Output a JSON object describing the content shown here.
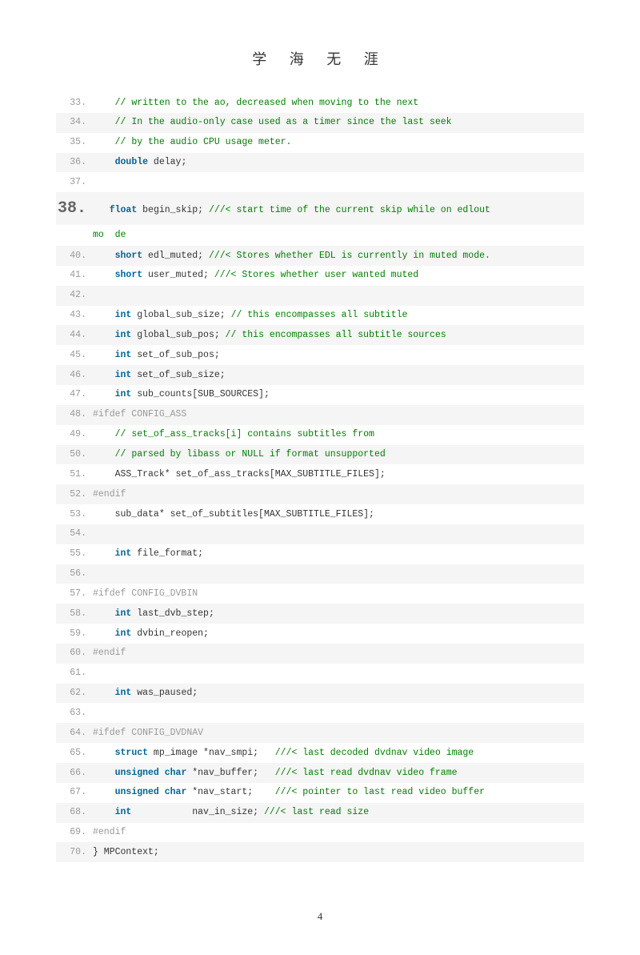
{
  "title": "学 海 无  涯",
  "page_number": "4",
  "lines": [
    {
      "n": "33.",
      "alt": false,
      "tokens": [
        {
          "t": "    ",
          "c": ""
        },
        {
          "t": "// written to the ao, decreased when moving to the next",
          "c": "comment"
        }
      ]
    },
    {
      "n": "34.",
      "alt": true,
      "tokens": [
        {
          "t": "    ",
          "c": ""
        },
        {
          "t": "// In the audio-only case used as a timer since the last seek",
          "c": "comment"
        }
      ]
    },
    {
      "n": "35.",
      "alt": false,
      "tokens": [
        {
          "t": "    ",
          "c": ""
        },
        {
          "t": "// by the audio CPU usage meter.",
          "c": "comment"
        }
      ]
    },
    {
      "n": "36.",
      "alt": true,
      "tokens": [
        {
          "t": "    ",
          "c": ""
        },
        {
          "t": "double",
          "c": "keyword"
        },
        {
          "t": " delay;",
          "c": "ident"
        }
      ]
    },
    {
      "n": "37.",
      "alt": false,
      "tokens": [
        {
          "t": "  ",
          "c": ""
        }
      ]
    },
    {
      "n": "38.",
      "alt": true,
      "big": true,
      "tokens": [
        {
          "t": "   ",
          "c": ""
        },
        {
          "t": "float",
          "c": "keyword"
        },
        {
          "t": " begin_skip; ",
          "c": "ident"
        },
        {
          "t": "///< start time of the current skip while on edlout",
          "c": "comment"
        }
      ],
      "wrap": [
        {
          "t": "mo  de",
          "c": "comment"
        }
      ]
    },
    {
      "n": "40.",
      "alt": true,
      "tokens": [
        {
          "t": "    ",
          "c": ""
        },
        {
          "t": "short",
          "c": "keyword"
        },
        {
          "t": " edl_muted; ",
          "c": "ident"
        },
        {
          "t": "///< Stores whether EDL is currently in muted mode.",
          "c": "comment"
        }
      ]
    },
    {
      "n": "41.",
      "alt": false,
      "tokens": [
        {
          "t": "    ",
          "c": ""
        },
        {
          "t": "short",
          "c": "keyword"
        },
        {
          "t": " user_muted; ",
          "c": "ident"
        },
        {
          "t": "///< Stores whether user wanted muted",
          "c": "comment"
        }
      ]
    },
    {
      "n": "42.",
      "alt": true,
      "tokens": [
        {
          "t": "  ",
          "c": ""
        }
      ]
    },
    {
      "n": "43.",
      "alt": false,
      "tokens": [
        {
          "t": "    ",
          "c": ""
        },
        {
          "t": "int",
          "c": "keyword"
        },
        {
          "t": " global_sub_size; ",
          "c": "ident"
        },
        {
          "t": "// this encompasses all subtitle",
          "c": "comment"
        }
      ]
    },
    {
      "n": "44.",
      "alt": true,
      "tokens": [
        {
          "t": "    ",
          "c": ""
        },
        {
          "t": "int",
          "c": "keyword"
        },
        {
          "t": " global_sub_pos; ",
          "c": "ident"
        },
        {
          "t": "// this encompasses all subtitle sources",
          "c": "comment"
        }
      ]
    },
    {
      "n": "45.",
      "alt": false,
      "tokens": [
        {
          "t": "    ",
          "c": ""
        },
        {
          "t": "int",
          "c": "keyword"
        },
        {
          "t": " set_of_sub_pos;",
          "c": "ident"
        }
      ]
    },
    {
      "n": "46.",
      "alt": true,
      "tokens": [
        {
          "t": "    ",
          "c": ""
        },
        {
          "t": "int",
          "c": "keyword"
        },
        {
          "t": " set_of_sub_size;",
          "c": "ident"
        }
      ]
    },
    {
      "n": "47.",
      "alt": false,
      "tokens": [
        {
          "t": "    ",
          "c": ""
        },
        {
          "t": "int",
          "c": "keyword"
        },
        {
          "t": " sub_counts[SUB_SOURCES];",
          "c": "ident"
        }
      ]
    },
    {
      "n": "48.",
      "alt": true,
      "tokens": [
        {
          "t": "#ifdef CONFIG_ASS",
          "c": "pp"
        }
      ]
    },
    {
      "n": "49.",
      "alt": false,
      "tokens": [
        {
          "t": "    ",
          "c": ""
        },
        {
          "t": "// set_of_ass_tracks[i] contains subtitles from",
          "c": "comment"
        }
      ]
    },
    {
      "n": "50.",
      "alt": true,
      "tokens": [
        {
          "t": "    ",
          "c": ""
        },
        {
          "t": "// parsed by libass or NULL if format unsupported",
          "c": "comment"
        }
      ]
    },
    {
      "n": "51.",
      "alt": false,
      "tokens": [
        {
          "t": "    ",
          "c": ""
        },
        {
          "t": "ASS_Track* set_of_ass_tracks[MAX_SUBTITLE_FILES];",
          "c": "ident"
        }
      ]
    },
    {
      "n": "52.",
      "alt": true,
      "tokens": [
        {
          "t": "#endif",
          "c": "pp"
        }
      ]
    },
    {
      "n": "53.",
      "alt": false,
      "tokens": [
        {
          "t": "    ",
          "c": ""
        },
        {
          "t": "sub_data* set_of_subtitles[MAX_SUBTITLE_FILES];",
          "c": "ident"
        }
      ]
    },
    {
      "n": "54.",
      "alt": true,
      "tokens": [
        {
          "t": "  ",
          "c": ""
        }
      ]
    },
    {
      "n": "55.",
      "alt": false,
      "tokens": [
        {
          "t": "    ",
          "c": ""
        },
        {
          "t": "int",
          "c": "keyword"
        },
        {
          "t": " file_format;",
          "c": "ident"
        }
      ]
    },
    {
      "n": "56.",
      "alt": true,
      "tokens": [
        {
          "t": "  ",
          "c": ""
        }
      ]
    },
    {
      "n": "57.",
      "alt": false,
      "tokens": [
        {
          "t": "#ifdef CONFIG_DVBIN",
          "c": "pp"
        }
      ]
    },
    {
      "n": "58.",
      "alt": true,
      "tokens": [
        {
          "t": "    ",
          "c": ""
        },
        {
          "t": "int",
          "c": "keyword"
        },
        {
          "t": " last_dvb_step;",
          "c": "ident"
        }
      ]
    },
    {
      "n": "59.",
      "alt": false,
      "tokens": [
        {
          "t": "    ",
          "c": ""
        },
        {
          "t": "int",
          "c": "keyword"
        },
        {
          "t": " dvbin_reopen;",
          "c": "ident"
        }
      ]
    },
    {
      "n": "60.",
      "alt": true,
      "tokens": [
        {
          "t": "#endif",
          "c": "pp"
        }
      ]
    },
    {
      "n": "61.",
      "alt": false,
      "tokens": [
        {
          "t": "  ",
          "c": ""
        }
      ]
    },
    {
      "n": "62.",
      "alt": true,
      "tokens": [
        {
          "t": "    ",
          "c": ""
        },
        {
          "t": "int",
          "c": "keyword"
        },
        {
          "t": " was_paused;",
          "c": "ident"
        }
      ]
    },
    {
      "n": "63.",
      "alt": false,
      "tokens": [
        {
          "t": "  ",
          "c": ""
        }
      ]
    },
    {
      "n": "64.",
      "alt": true,
      "tokens": [
        {
          "t": "#ifdef CONFIG_DVDNAV",
          "c": "pp"
        }
      ]
    },
    {
      "n": "65.",
      "alt": false,
      "tokens": [
        {
          "t": "    ",
          "c": ""
        },
        {
          "t": "struct",
          "c": "keyword"
        },
        {
          "t": " mp_image *nav_smpi;   ",
          "c": "ident"
        },
        {
          "t": "///< last decoded dvdnav video image",
          "c": "comment"
        }
      ]
    },
    {
      "n": "66.",
      "alt": true,
      "tokens": [
        {
          "t": "    ",
          "c": ""
        },
        {
          "t": "unsigned ",
          "c": "keyword"
        },
        {
          "t": "char",
          "c": "keyword"
        },
        {
          "t": " *nav_buffer;   ",
          "c": "ident"
        },
        {
          "t": "///< last read dvdnav video frame",
          "c": "comment"
        }
      ]
    },
    {
      "n": "67.",
      "alt": false,
      "tokens": [
        {
          "t": "    ",
          "c": ""
        },
        {
          "t": "unsigned ",
          "c": "keyword"
        },
        {
          "t": "char",
          "c": "keyword"
        },
        {
          "t": " *nav_start;    ",
          "c": "ident"
        },
        {
          "t": "///< pointer to last read video buffer",
          "c": "comment"
        }
      ]
    },
    {
      "n": "68.",
      "alt": true,
      "tokens": [
        {
          "t": "    ",
          "c": ""
        },
        {
          "t": "int",
          "c": "keyword"
        },
        {
          "t": "           nav_in_size; ",
          "c": "ident"
        },
        {
          "t": "///< last read size",
          "c": "comment"
        }
      ]
    },
    {
      "n": "69.",
      "alt": false,
      "tokens": [
        {
          "t": "#endif",
          "c": "pp"
        }
      ]
    },
    {
      "n": "70.",
      "alt": true,
      "tokens": [
        {
          "t": "} MPContext;",
          "c": "ident"
        }
      ]
    }
  ]
}
